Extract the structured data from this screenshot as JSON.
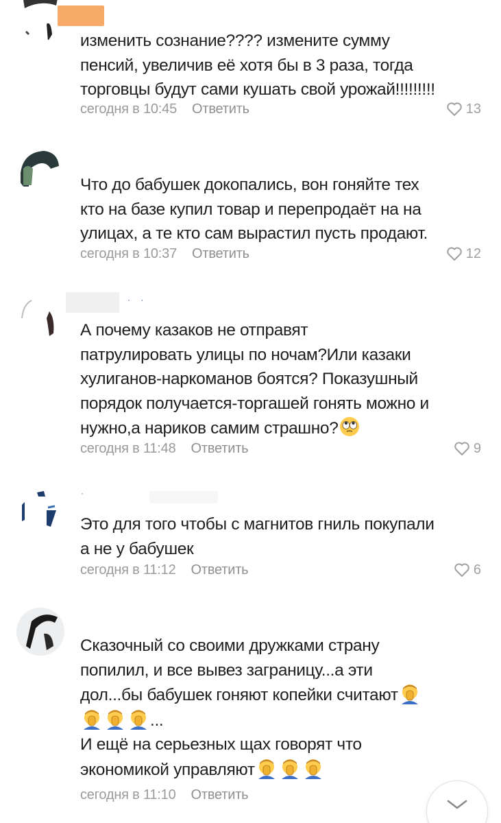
{
  "reply_label": "Ответить",
  "comments": [
    {
      "lines": [
        "изменить сознание???? измените сумму",
        "пенсий, увеличив её хотя бы в 3 раза, тогда",
        "торговцы будут сами кушать свой урожай!!!!!!!!!"
      ],
      "time": "сегодня в 10:45",
      "likes": "13"
    },
    {
      "lines": [
        "Что до бабушек докопались, вон гоняйте тех",
        "кто на базе купил товар и перепродаёт на на",
        "улицах, а те кто сам вырастил пусть продают."
      ],
      "time": "сегодня в 10:37",
      "likes": "12"
    },
    {
      "lines": [
        "А почему казаков не отправят",
        "патрулировать улицы по ночам?Или казаки",
        "хулиганов-наркоманов боятся? Показушный",
        "порядок получается-торгашей гонять можно и",
        "нужно,а нариков самим страшно?"
      ],
      "emoji_after": "rolling-eyes",
      "time": "сегодня в 11:48",
      "likes": "9"
    },
    {
      "lines": [
        "Это для того чтобы с магнитов гниль покупали",
        "а не у бабушек"
      ],
      "time": "сегодня в 11:12",
      "likes": "6"
    },
    {
      "line1": "Сказочный со своими дружками страну",
      "line2": "попилил, и все вывез заграницу...а эти",
      "line3": "дол...бы бабушек гоняют копейки считают",
      "line4_suffix": "...",
      "line5": "И ещё на серьезных щах говорят что",
      "line6": "экономикой управляют",
      "time": "сегодня в 11:10"
    }
  ],
  "scroll_button_icon": "chevron-down-icon",
  "like_icon": "heart-outline-icon",
  "colors": {
    "meta": "#9a9a9a",
    "text": "#1e1e1e",
    "author_blur": "#f7a968"
  }
}
